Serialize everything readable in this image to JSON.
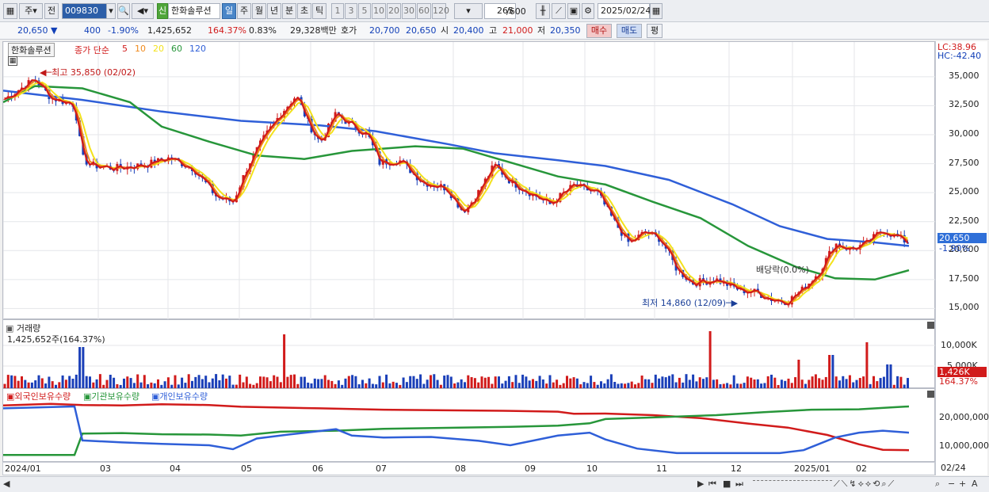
{
  "toolbar": {
    "period_label": "주",
    "prev_label": "전",
    "stock_code": "009830",
    "stock_name_badge": "신",
    "stock_name": "한화솔루션",
    "periods": [
      "일",
      "주",
      "월",
      "년",
      "분",
      "초",
      "틱"
    ],
    "selected_period": "일",
    "minute_units": [
      "1",
      "3",
      "5",
      "10",
      "20",
      "30",
      "60",
      "120"
    ],
    "count_value": "265",
    "count_max": "/600",
    "date_value": "2025/02/24"
  },
  "quote": {
    "price": "20,650",
    "price_arrow": "▼",
    "change": "400",
    "change_pct": "-1.90%",
    "volume": "1,425,652",
    "volume_ratio": "164.37%",
    "turnover": "0.83%",
    "trade_value": "29,328백만",
    "ask_label": "호가",
    "ask1": "20,700",
    "ask2": "20,650",
    "open_label": "시",
    "open": "20,400",
    "high_label": "고",
    "high": "21,000",
    "low_label": "저",
    "low": "20,350",
    "buy_label": "매수",
    "sell_label": "매도",
    "eval_label": "평"
  },
  "price_chart": {
    "title": "한화솔루션",
    "legend_prefix": "종가 단순",
    "ma_periods": [
      "5",
      "10",
      "20",
      "60",
      "120"
    ],
    "ma_colors": [
      "#d11b1b",
      "#f08a1c",
      "#f3e21b",
      "#27963a",
      "#2f5fd8"
    ],
    "lc_label": "LC:38.96",
    "hc_label": "HC:-42.40",
    "y_ticks": [
      "35,000",
      "32,500",
      "30,000",
      "27,500",
      "25,000",
      "22,500",
      "20,000",
      "17,500",
      "15,000"
    ],
    "current_price_tag": "20,650",
    "current_change_tag": "-1.90%",
    "high_annotation": "최고 35,850 (02/02)",
    "low_annotation": "최저 14,860 (12/09)",
    "dividend_annotation": "배당락(0.0%)"
  },
  "volume_chart": {
    "title": "거래량",
    "value_label": "1,425,652주(164.37%)",
    "y_ticks": [
      "10,000K",
      "5,000K"
    ],
    "current_tag": "1,426K",
    "current_pct_tag": "164.37%"
  },
  "holdings_chart": {
    "legend": [
      "외국인보유수량",
      "기관보유수량",
      "개인보유수량"
    ],
    "colors": [
      "#d11b1b",
      "#27963a",
      "#2f5fd8"
    ],
    "y_ticks": [
      "20,000,000",
      "10,000,000"
    ]
  },
  "x_axis": {
    "labels": [
      "2024/01",
      "03",
      "04",
      "05",
      "06",
      "07",
      "08",
      "09",
      "10",
      "11",
      "12",
      "2025/01",
      "02"
    ],
    "right_label": "02/24"
  },
  "chart_data": {
    "type": "line",
    "title": "",
    "x": [
      "2024/01",
      "03",
      "04",
      "05",
      "06",
      "07",
      "08",
      "09",
      "10",
      "11",
      "12",
      "2025/01",
      "02"
    ],
    "series": [
      {
        "name": "5",
        "values": [
          33000,
          27200,
          28000,
          24000,
          31500,
          28500,
          26000,
          23500,
          25000,
          20000,
          16800,
          18000,
          21000
        ]
      },
      {
        "name": "120",
        "values": [
          33800,
          32500,
          31600,
          31000,
          30700,
          29500,
          28500,
          27900,
          27500,
          25500,
          21500,
          20300,
          20800
        ]
      },
      {
        "name": "외국인보유수량",
        "values": [
          27000,
          26500,
          27500,
          26000,
          25000,
          24000,
          23000,
          22500,
          20000,
          19000,
          14000,
          10000,
          4000
        ]
      },
      {
        "name": "기관보유수량",
        "values": [
          2000,
          11000,
          11500,
          12000,
          13500,
          14500,
          15500,
          16500,
          18000,
          21000,
          23500,
          25000,
          26500
        ]
      },
      {
        "name": "개인보유수량",
        "values": [
          26000,
          9000,
          7500,
          6500,
          11500,
          10500,
          9000,
          7000,
          13500,
          5000,
          2500,
          3500,
          15000
        ]
      }
    ],
    "ylim": [
      14000,
      38000
    ]
  }
}
